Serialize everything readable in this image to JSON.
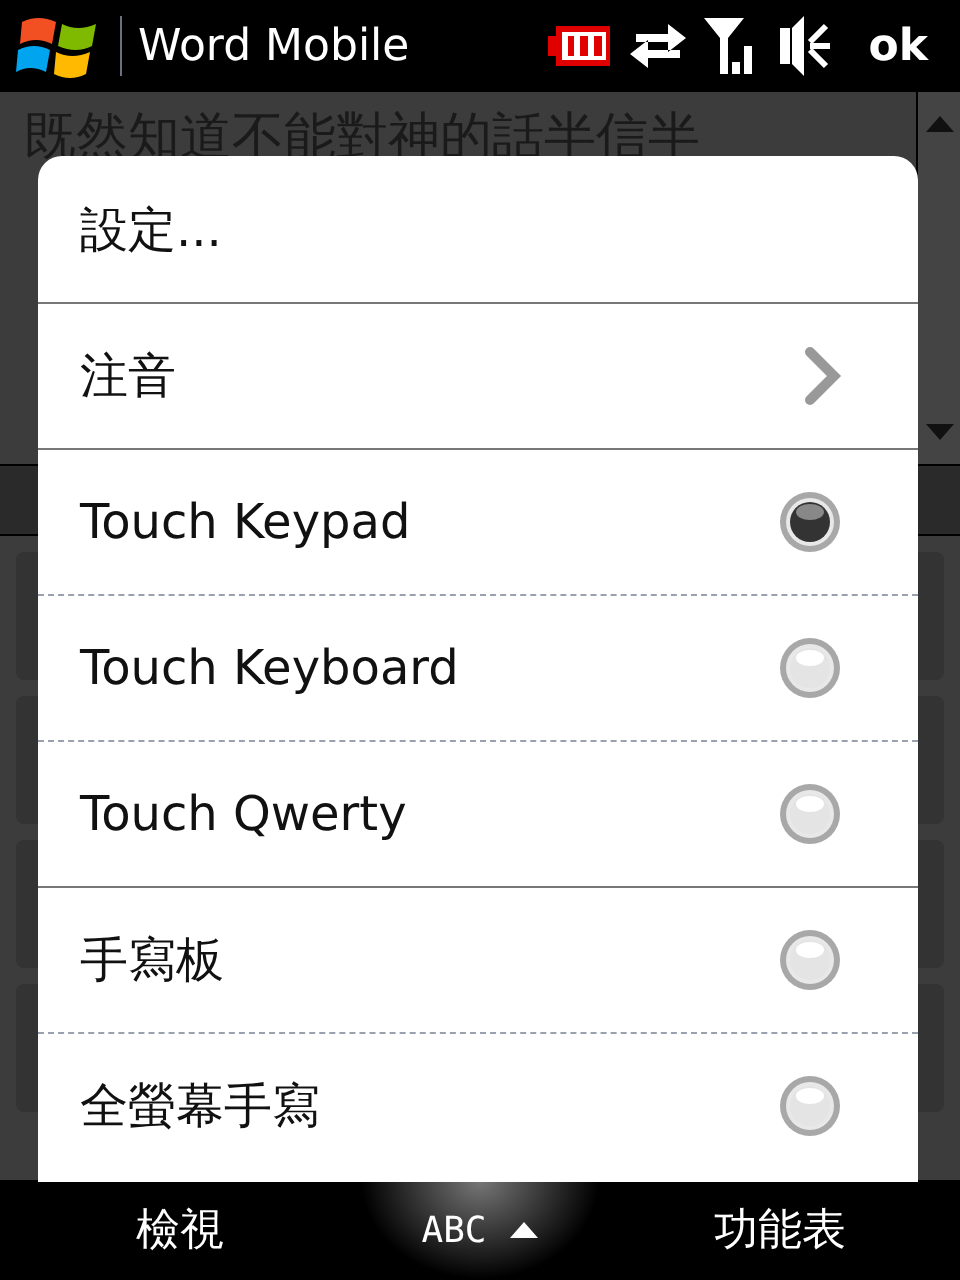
{
  "title_bar": {
    "title": "Word Mobile",
    "ok": "ok"
  },
  "document": {
    "first_line": "既然知道不能對神的話半信半"
  },
  "menu": {
    "groups": [
      [
        {
          "kind": "command",
          "label": "設定..."
        }
      ],
      [
        {
          "kind": "submenu",
          "label": "注音"
        }
      ],
      [
        {
          "kind": "radio",
          "label": "Touch Keypad",
          "selected": true
        },
        {
          "kind": "radio",
          "label": "Touch Keyboard",
          "selected": false
        },
        {
          "kind": "radio",
          "label": "Touch Qwerty",
          "selected": false
        }
      ],
      [
        {
          "kind": "radio",
          "label": "手寫板",
          "selected": false
        },
        {
          "kind": "radio",
          "label": "全螢幕手寫",
          "selected": false
        }
      ]
    ]
  },
  "soft_keys": {
    "left": "檢視",
    "input": "ABC",
    "right": "功能表"
  }
}
